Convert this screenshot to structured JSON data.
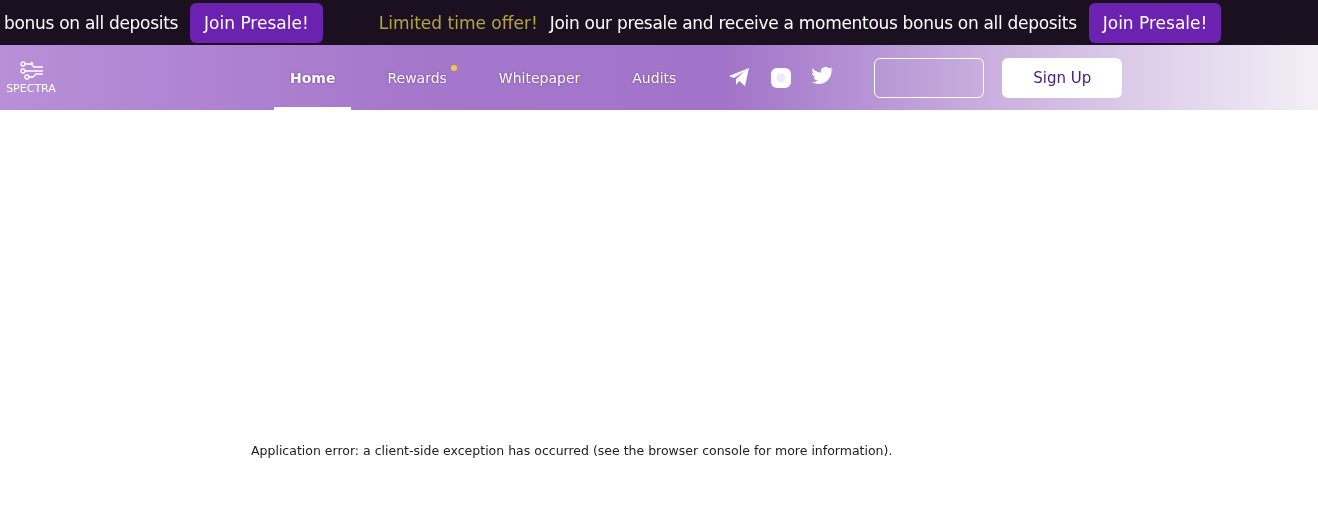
{
  "ticker": {
    "segments": [
      {
        "message": "bonus on all deposits",
        "button": "Join Presale!"
      },
      {
        "highlight": "Limited time offer!",
        "message": "Join our presale and receive a momentous bonus on all deposits",
        "button": "Join Presale!"
      }
    ]
  },
  "header": {
    "logo": "SPECTRA",
    "nav": [
      {
        "label": "Home",
        "selected": true,
        "badge": false
      },
      {
        "label": "Rewards",
        "selected": false,
        "badge": true
      },
      {
        "label": "Whitepaper",
        "selected": false,
        "badge": false
      },
      {
        "label": "Audits",
        "selected": false,
        "badge": false
      }
    ],
    "signup": "Sign Up"
  },
  "error": "Application error: a client-side exception has occurred (see the browser console for more information)."
}
